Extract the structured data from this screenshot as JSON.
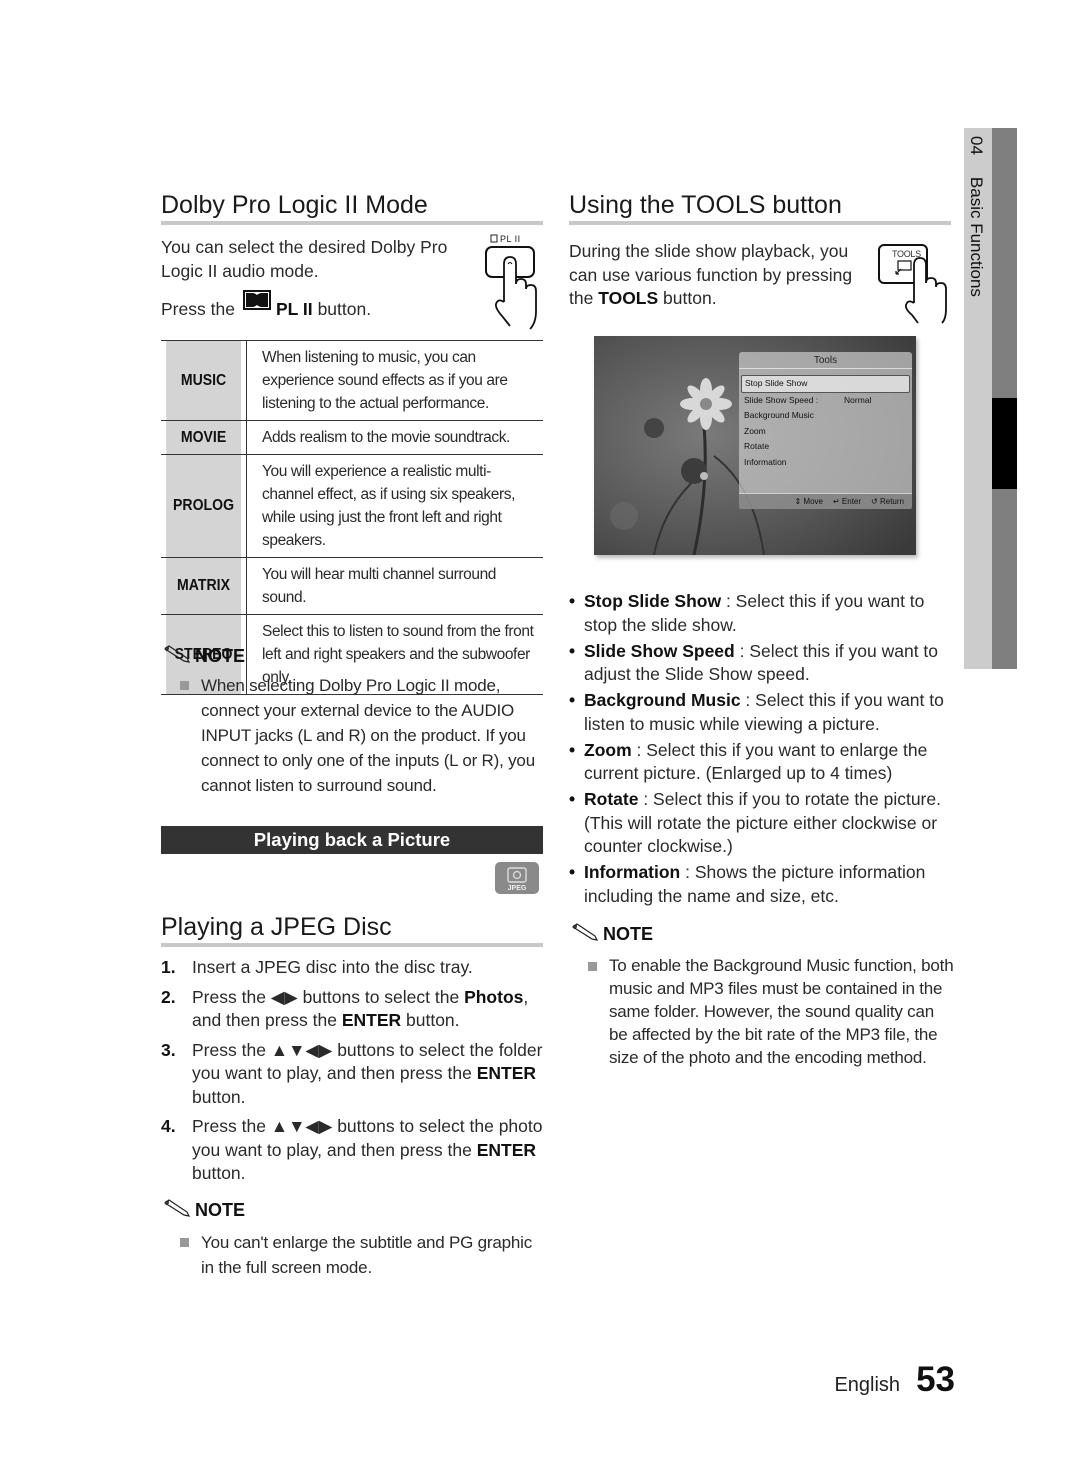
{
  "page": {
    "language": "English",
    "number": "53",
    "chapter_number": "04",
    "chapter_title": "Basic Functions"
  },
  "dolby": {
    "title": "Dolby Pro Logic II Mode",
    "intro": "You can select the desired Dolby Pro Logic II audio mode.",
    "press_prefix": "Press the",
    "press_button": "PL II",
    "press_suffix": "button.",
    "remote_label": "PL II",
    "modes": [
      {
        "mode": "MUSIC",
        "desc": "When listening to music, you can experience sound effects as if you are listening to the actual performance."
      },
      {
        "mode": "MOVIE",
        "desc": "Adds realism to the movie soundtrack."
      },
      {
        "mode": "PROLOG",
        "desc": "You will experience a realistic multi-channel effect, as if using six speakers, while using just the front left and right speakers."
      },
      {
        "mode": "MATRIX",
        "desc": "You will hear multi channel surround sound."
      },
      {
        "mode": "STEREO",
        "desc": "Select this to listen to sound from the front left and right speakers and the subwoofer only."
      }
    ],
    "note_label": "NOTE",
    "note": "When selecting Dolby Pro Logic II mode, connect your external device to the AUDIO INPUT jacks (L and R) on the product. If you connect to only one of the inputs (L or R), you cannot listen to surround sound."
  },
  "picture_bar": "Playing back a Picture",
  "jpeg_badge": "JPEG",
  "jpeg": {
    "title": "Playing a JPEG Disc",
    "steps": [
      {
        "num": "1.",
        "parts": [
          [
            "Insert a JPEG disc into the disc tray.",
            false
          ]
        ]
      },
      {
        "num": "2.",
        "parts": [
          [
            "Press the ◀▶ buttons to select the ",
            false
          ],
          [
            "Photos",
            true
          ],
          [
            ", and then press the ",
            false
          ],
          [
            "ENTER",
            true
          ],
          [
            " button.",
            false
          ]
        ]
      },
      {
        "num": "3.",
        "parts": [
          [
            "Press the ▲▼◀▶ buttons to select the folder you want to play, and then press the ",
            false
          ],
          [
            "ENTER",
            true
          ],
          [
            " button.",
            false
          ]
        ]
      },
      {
        "num": "4.",
        "parts": [
          [
            "Press the ▲▼◀▶ buttons to select the photo you want to play, and then press the ",
            false
          ],
          [
            "ENTER",
            true
          ],
          [
            " button.",
            false
          ]
        ]
      }
    ],
    "note_label": "NOTE",
    "note": "You can't enlarge the subtitle and PG graphic in the full screen mode."
  },
  "tools": {
    "title": "Using the TOOLS button",
    "intro_pre": "During the slide show playback, you can use various function by pressing the ",
    "intro_bold": "TOOLS",
    "intro_post": " button.",
    "remote_label": "TOOLS",
    "screen": {
      "panel_title": "Tools",
      "items": [
        {
          "label": "Stop Slide Show",
          "value": ""
        },
        {
          "label": "Slide Show Speed :",
          "value": "Normal"
        },
        {
          "label": "Background Music",
          "value": ""
        },
        {
          "label": "Zoom",
          "value": ""
        },
        {
          "label": "Rotate",
          "value": ""
        },
        {
          "label": "Information",
          "value": ""
        }
      ],
      "selected_index": 0,
      "footer": {
        "move": "Move",
        "enter": "Enter",
        "return": "Return"
      }
    },
    "bullets": [
      {
        "term": "Stop Slide Show",
        "text": " : Select this if you want to stop the slide show."
      },
      {
        "term": "Slide Show Speed",
        "text": " : Select this if you want to adjust the Slide Show speed."
      },
      {
        "term": "Background Music",
        "text": " : Select this if you want to listen to music while viewing a picture."
      },
      {
        "term": "Zoom",
        "text": " : Select this if you want to enlarge the current picture. (Enlarged up to 4 times)"
      },
      {
        "term": "Rotate",
        "text": " : Select this if you to rotate the picture. (This will rotate the picture either clockwise or counter clockwise.)"
      },
      {
        "term": "Information",
        "text": " : Shows the picture information including the name and size, etc."
      }
    ],
    "note_label": "NOTE",
    "note": "To enable the Background Music function, both music and MP3 files must be contained in the same folder. However, the sound quality can be affected by the bit rate of the MP3 file, the size of the photo and the encoding method."
  }
}
